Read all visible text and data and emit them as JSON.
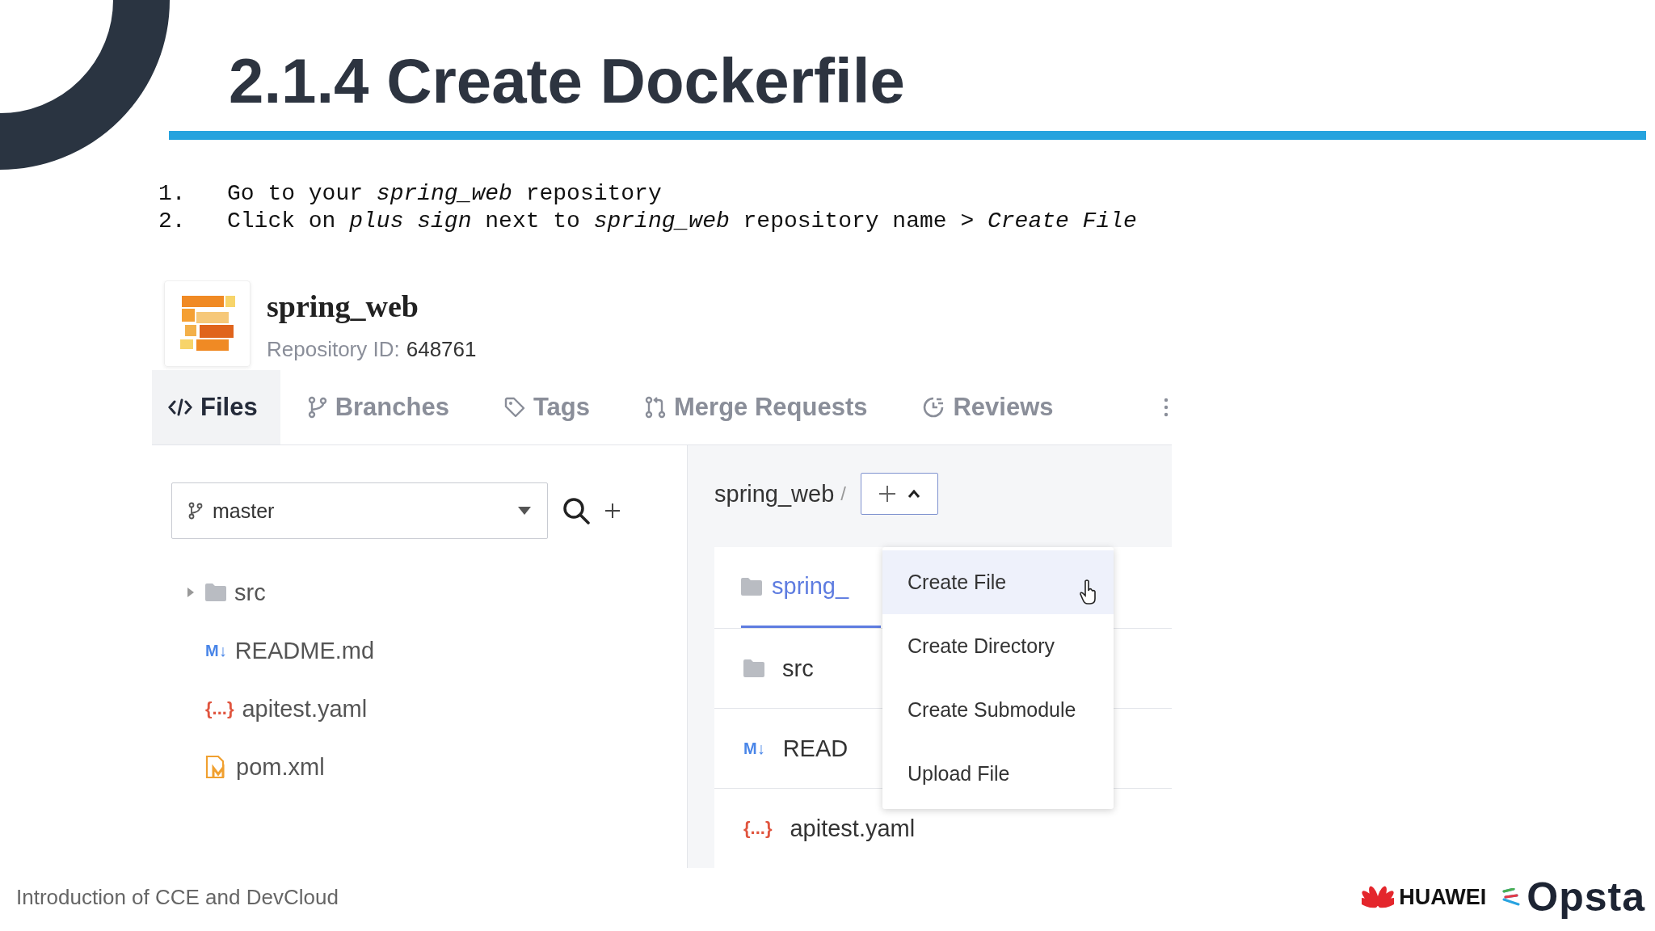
{
  "slide": {
    "title": "2.1.4 Create Dockerfile",
    "steps": [
      {
        "number": "1.",
        "text": "Go to your *spring_web* repository"
      },
      {
        "number": "2.",
        "text": "Click on *plus sign* next to *spring_web* repository name > *Create File*"
      }
    ]
  },
  "repo": {
    "name": "spring_web",
    "id_label": "Repository ID:",
    "id_value": "648761"
  },
  "tabs": [
    {
      "label": "Files",
      "kind": "code",
      "selected": true
    },
    {
      "label": "Branches",
      "kind": "branch",
      "selected": false
    },
    {
      "label": "Tags",
      "kind": "tag",
      "selected": false
    },
    {
      "label": "Merge Requests",
      "kind": "merge",
      "selected": false
    },
    {
      "label": "Reviews",
      "kind": "review",
      "selected": false
    }
  ],
  "branch_select": {
    "value": "master"
  },
  "file_tree": [
    {
      "name": "src",
      "kind": "folder",
      "expanded": false
    },
    {
      "name": "README.md",
      "kind": "markdown",
      "icon": "M↓"
    },
    {
      "name": "apitest.yaml",
      "kind": "yaml",
      "icon": "{...}"
    },
    {
      "name": "pom.xml",
      "kind": "xml"
    }
  ],
  "breadcrumb": {
    "repo": "spring_web",
    "separator": "/"
  },
  "file_list": {
    "header": "spring_",
    "rows": [
      {
        "name": "src",
        "kind": "folder"
      },
      {
        "name": "READ",
        "kind": "markdown",
        "icon": "M↓"
      },
      {
        "name": "apitest.yaml",
        "kind": "yaml",
        "icon": "{...}"
      }
    ]
  },
  "add_menu": [
    {
      "label": "Create File",
      "selected": true
    },
    {
      "label": "Create Directory",
      "selected": false
    },
    {
      "label": "Create Submodule",
      "selected": false
    },
    {
      "label": "Upload File",
      "selected": false
    }
  ],
  "footer": {
    "text": "Introduction of CCE and DevCloud",
    "logos": [
      "HUAWEI",
      "Opsta"
    ]
  }
}
